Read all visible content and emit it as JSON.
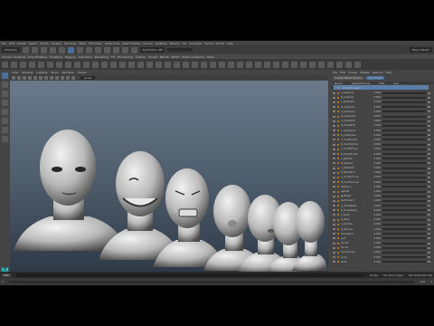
{
  "menubar": {
    "items": [
      "File",
      "Edit",
      "Create",
      "Select",
      "Modify",
      "Display",
      "Windows",
      "Mesh",
      "Edit Mesh",
      "Mesh Tools",
      "Mesh Display",
      "Curves",
      "Surfaces",
      "Deform",
      "UV",
      "Generate",
      "Cache",
      "Arnold",
      "Help"
    ],
    "workspace_label": "Maya Classic"
  },
  "statusline": {
    "menuset": "Modeling",
    "symmetry": "Symmetry: Off",
    "search_placeholder": ""
  },
  "shelf": {
    "tabs": [
      "Curves / Surfaces",
      "Poly Modeling",
      "Sculpting",
      "Rigging",
      "Animation",
      "Rendering",
      "FX",
      "FX Caching",
      "Custom",
      "Arnold",
      "Bifrost",
      "MASH",
      "Motion Graphics",
      "XGen"
    ]
  },
  "viewport": {
    "menu": [
      "View",
      "Shading",
      "Lighting",
      "Show",
      "Renderer",
      "Panels"
    ],
    "camera_field": "persp"
  },
  "shape_editor": {
    "menu": [
      "File",
      "Edit",
      "Create",
      "Shapes",
      "Options",
      "Help"
    ],
    "buttons": [
      "Create Blend Shape",
      "Add Target"
    ],
    "columns": [
      "Name",
      "Weight/Driver",
      "Edit",
      "Key"
    ],
    "blendshape_node": "blendShape1",
    "targets": [
      {
        "name": "L_eyebrow",
        "weight": "0.000",
        "fill": 0.0
      },
      {
        "name": "R_eyebrow",
        "weight": "0.000",
        "fill": 0.0
      },
      {
        "name": "L_eyeSmile",
        "weight": "0.000",
        "fill": 0.0
      },
      {
        "name": "R_eyeSmile",
        "weight": "0.000",
        "fill": 0.0
      },
      {
        "name": "L_eyeSquint",
        "weight": "0.000",
        "fill": 0.0
      },
      {
        "name": "R_eyeSquint",
        "weight": "0.000",
        "fill": 0.0
      },
      {
        "name": "L_cheekPuff",
        "weight": "0.000",
        "fill": 0.0
      },
      {
        "name": "R_cheekPuff",
        "weight": "0.000",
        "fill": 0.0
      },
      {
        "name": "L_noseSneer",
        "weight": "0.000",
        "fill": 0.0
      },
      {
        "name": "R_noseSneer",
        "weight": "0.000",
        "fill": 0.0
      },
      {
        "name": "L_mouthSmile",
        "weight": "0.000",
        "fill": 0.0
      },
      {
        "name": "R_mouthSmile",
        "weight": "0.000",
        "fill": 0.0
      },
      {
        "name": "L_mouthFrown",
        "weight": "0.000",
        "fill": 0.0
      },
      {
        "name": "R_mouthFrown",
        "weight": "0.000",
        "fill": 0.0
      },
      {
        "name": "L_lipPress",
        "weight": "0.000",
        "fill": 0.0
      },
      {
        "name": "R_lipPress",
        "weight": "0.000",
        "fill": 0.0
      },
      {
        "name": "L_lipStretch",
        "weight": "0.000",
        "fill": 0.0
      },
      {
        "name": "R_lipStretch",
        "weight": "0.000",
        "fill": 0.0
      },
      {
        "name": "L_mouthCorner",
        "weight": "0.000",
        "fill": 0.0
      },
      {
        "name": "R_mouthCorner",
        "weight": "0.000",
        "fill": 0.0
      },
      {
        "name": "jawOpen",
        "weight": "0.000",
        "fill": 0.0
      },
      {
        "name": "jawLeft",
        "weight": "0.000",
        "fill": 0.0
      },
      {
        "name": "jawRight",
        "weight": "0.000",
        "fill": 0.0
      },
      {
        "name": "jawForward",
        "weight": "0.000",
        "fill": 0.0
      },
      {
        "name": "L_cheekRaise",
        "weight": "0.000",
        "fill": 0.0
      },
      {
        "name": "R_cheekRaise",
        "weight": "0.000",
        "fill": 0.0
      },
      {
        "name": "L_lipUp",
        "weight": "0.000",
        "fill": 0.0
      },
      {
        "name": "R_lipUp",
        "weight": "0.000",
        "fill": 0.0
      },
      {
        "name": "L_lipDown",
        "weight": "0.000",
        "fill": 0.0
      },
      {
        "name": "R_lipDown",
        "weight": "0.000",
        "fill": 0.0
      },
      {
        "name": "tongueOut",
        "weight": "0.000",
        "fill": 0.0
      },
      {
        "name": "puff",
        "weight": "0.000",
        "fill": 0.0
      },
      {
        "name": "pucker",
        "weight": "0.000",
        "fill": 0.0
      },
      {
        "name": "funnel",
        "weight": "0.000",
        "fill": 0.0
      },
      {
        "name": "mouthClose",
        "weight": "0.000",
        "fill": 0.0
      },
      {
        "name": "sneer",
        "weight": "0.000",
        "fill": 0.0
      },
      {
        "name": "blink",
        "weight": "0.000",
        "fill": 0.0
      }
    ]
  },
  "timeslider": {
    "start": "1",
    "end": "120",
    "current": "1"
  },
  "cmdline": {
    "label": "MEL",
    "fps": "24 fps",
    "anim_layer": "No Anim Layer",
    "char_set": "No Character Set"
  },
  "colors": {
    "accent": "#5a7ea6",
    "maya_logo": "#24c4c8",
    "key_dot": "#c98a2e"
  }
}
